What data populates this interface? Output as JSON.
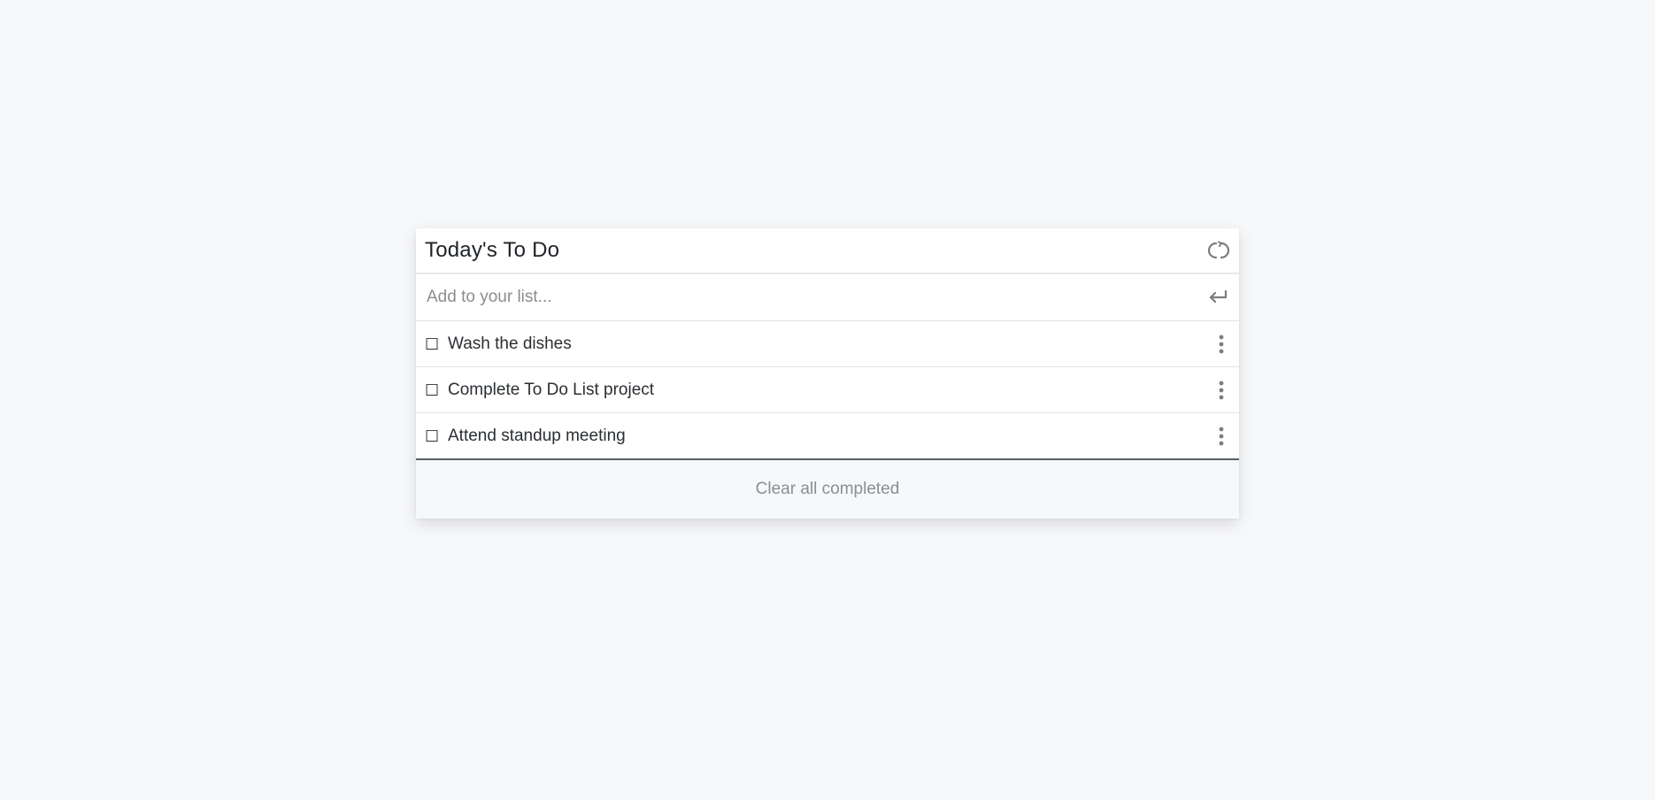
{
  "todo": {
    "title": "Today's To Do",
    "input": {
      "placeholder": "Add to your list...",
      "value": ""
    },
    "icons": {
      "refresh": "refresh-icon",
      "enter": "enter-icon",
      "checkbox": "checkbox-icon",
      "menu": "kebab-menu-icon"
    },
    "checkbox_glyph": "☐",
    "items": [
      {
        "label": "Wash the dishes",
        "completed": false
      },
      {
        "label": "Complete To Do List project",
        "completed": false
      },
      {
        "label": "Attend standup meeting",
        "completed": false
      }
    ],
    "clear_label": "Clear all completed"
  },
  "colors": {
    "background": "#f7f8fa",
    "card": "#ffffff",
    "icon_gray": "#7a7d81",
    "muted_text": "#8b8e92"
  }
}
